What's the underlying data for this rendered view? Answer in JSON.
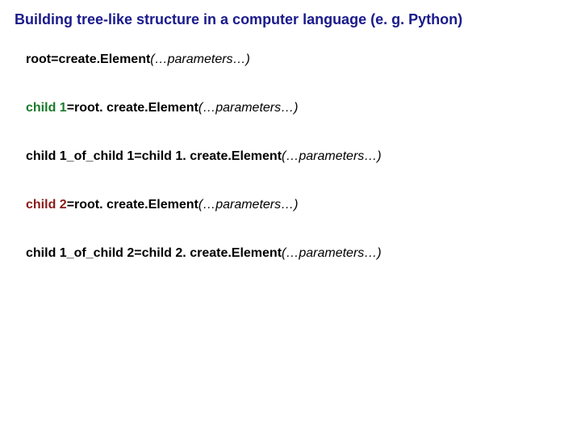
{
  "title": "Building tree-like structure in a computer language (e. g. Python)",
  "lines": [
    {
      "var": "root",
      "varClass": "var-bold",
      "eq": "=",
      "prefix": "",
      "fn": "create.Element",
      "params": "(…parameters…)"
    },
    {
      "var": "child 1",
      "varClass": "var-colored green",
      "eq": "=",
      "prefix": "root. ",
      "fn": "create.Element",
      "params": "(…parameters…)"
    },
    {
      "var": "child 1_of_child 1",
      "varClass": "var-bold",
      "eq": "=",
      "prefix": "child 1. ",
      "fn": "create.Element",
      "params": "(…parameters…)"
    },
    {
      "var": "child 2",
      "varClass": "var-colored darkred",
      "eq": "=",
      "prefix": "root. ",
      "fn": "create.Element",
      "params": "(…parameters…)"
    },
    {
      "var": "child 1_of_child 2",
      "varClass": "var-bold",
      "eq": "=",
      "prefix": "child 2. ",
      "fn": "create.Element",
      "params": "(…parameters…)"
    }
  ]
}
